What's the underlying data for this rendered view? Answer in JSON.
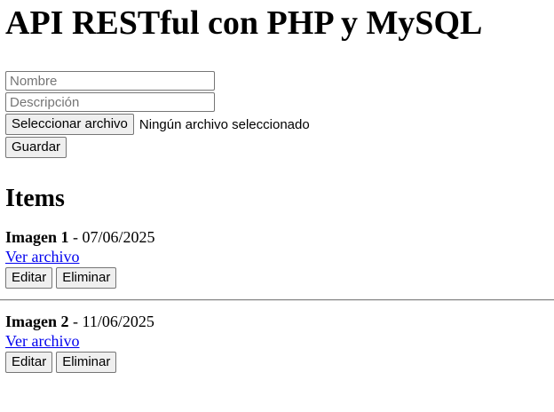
{
  "page": {
    "title": "API RESTful con PHP y MySQL"
  },
  "form": {
    "name_placeholder": "Nombre",
    "description_placeholder": "Descripción",
    "file_button_label": "Seleccionar archivo",
    "file_status": "Ningún archivo seleccionado",
    "save_label": "Guardar"
  },
  "items_section": {
    "heading": "Items"
  },
  "items": [
    {
      "name": "Imagen 1",
      "separator": " - ",
      "date": "07/06/2025",
      "link_label": "Ver archivo",
      "edit_label": "Editar",
      "delete_label": "Eliminar"
    },
    {
      "name": "Imagen 2",
      "separator": " - ",
      "date": "11/06/2025",
      "link_label": "Ver archivo",
      "edit_label": "Editar",
      "delete_label": "Eliminar"
    }
  ]
}
